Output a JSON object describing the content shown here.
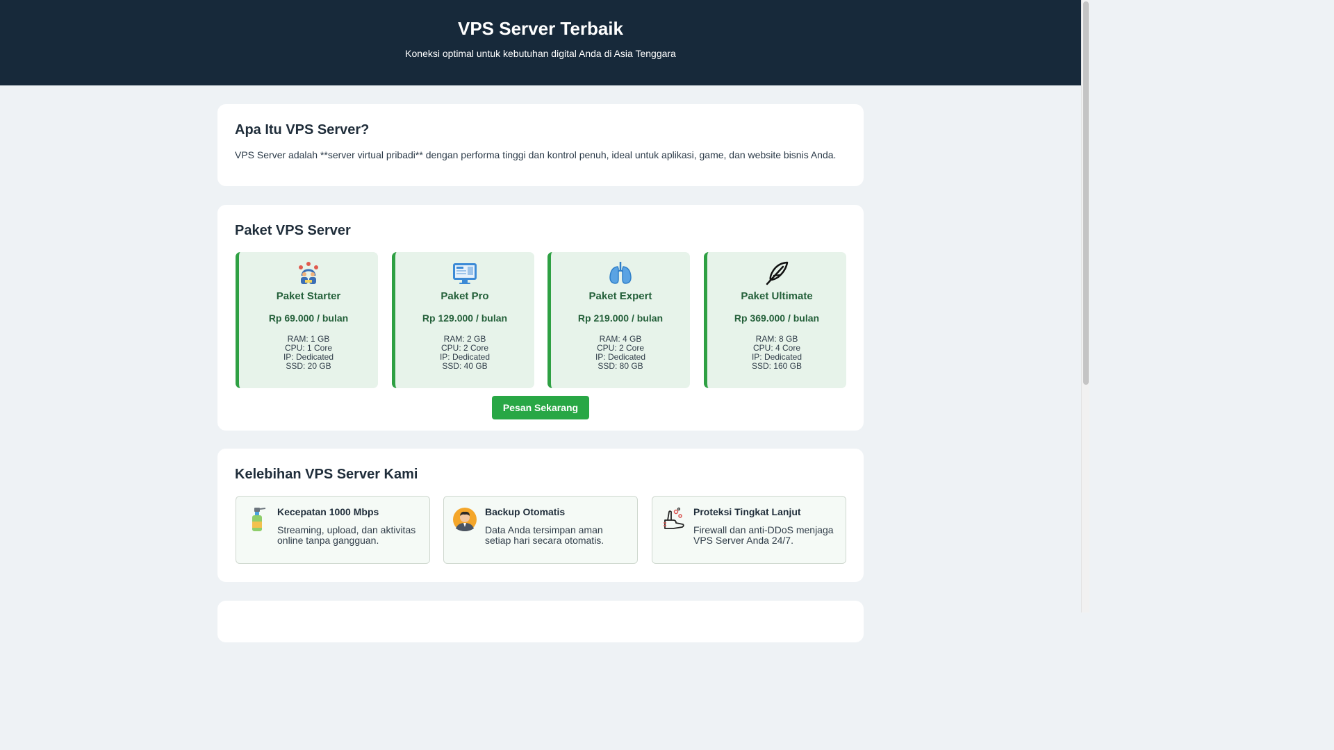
{
  "header": {
    "title": "VPS Server Terbaik",
    "subtitle": "Koneksi optimal untuk kebutuhan digital Anda di Asia Tenggara"
  },
  "intro": {
    "title": "Apa Itu VPS Server?",
    "text": "VPS Server adalah **server virtual pribadi** dengan performa tinggi dan kontrol penuh, ideal untuk aplikasi, game, dan website bisnis Anda."
  },
  "plans_section": {
    "title": "Paket VPS Server",
    "order_button": "Pesan Sekarang",
    "plans": [
      {
        "icon": "team-people-icon",
        "name": "Paket Starter",
        "price": "Rp 69.000 / bulan",
        "ram": "RAM: 1 GB",
        "cpu": "CPU: 1 Core",
        "ip": "IP: Dedicated",
        "ssd": "SSD: 20 GB"
      },
      {
        "icon": "monitor-icon",
        "name": "Paket Pro",
        "price": "Rp 129.000 / bulan",
        "ram": "RAM: 2 GB",
        "cpu": "CPU: 2 Core",
        "ip": "IP: Dedicated",
        "ssd": "SSD: 40 GB"
      },
      {
        "icon": "lungs-icon",
        "name": "Paket Expert",
        "price": "Rp 219.000 / bulan",
        "ram": "RAM: 4 GB",
        "cpu": "CPU: 2 Core",
        "ip": "IP: Dedicated",
        "ssd": "SSD: 80 GB"
      },
      {
        "icon": "feather-icon",
        "name": "Paket Ultimate",
        "price": "Rp 369.000 / bulan",
        "ram": "RAM: 8 GB",
        "cpu": "CPU: 4 Core",
        "ip": "IP: Dedicated",
        "ssd": "SSD: 160 GB"
      }
    ]
  },
  "features_section": {
    "title": "Kelebihan VPS Server Kami",
    "features": [
      {
        "icon": "spray-bottle-icon",
        "title": "Kecepatan 1000 Mbps",
        "desc": "Streaming, upload, dan aktivitas online tanpa gangguan."
      },
      {
        "icon": "person-avatar-icon",
        "title": "Backup Otomatis",
        "desc": "Data Anda tersimpan aman setiap hari secara otomatis."
      },
      {
        "icon": "hand-washing-icon",
        "title": "Proteksi Tingkat Lanjut",
        "desc": "Firewall dan anti-DDoS menjaga VPS Server Anda 24/7."
      }
    ]
  },
  "colors": {
    "header_bg": "#17293a",
    "accent_green": "#28a745",
    "plan_bg": "#e7f3ea",
    "plan_text": "#24603a",
    "page_bg": "#eef2f5"
  }
}
